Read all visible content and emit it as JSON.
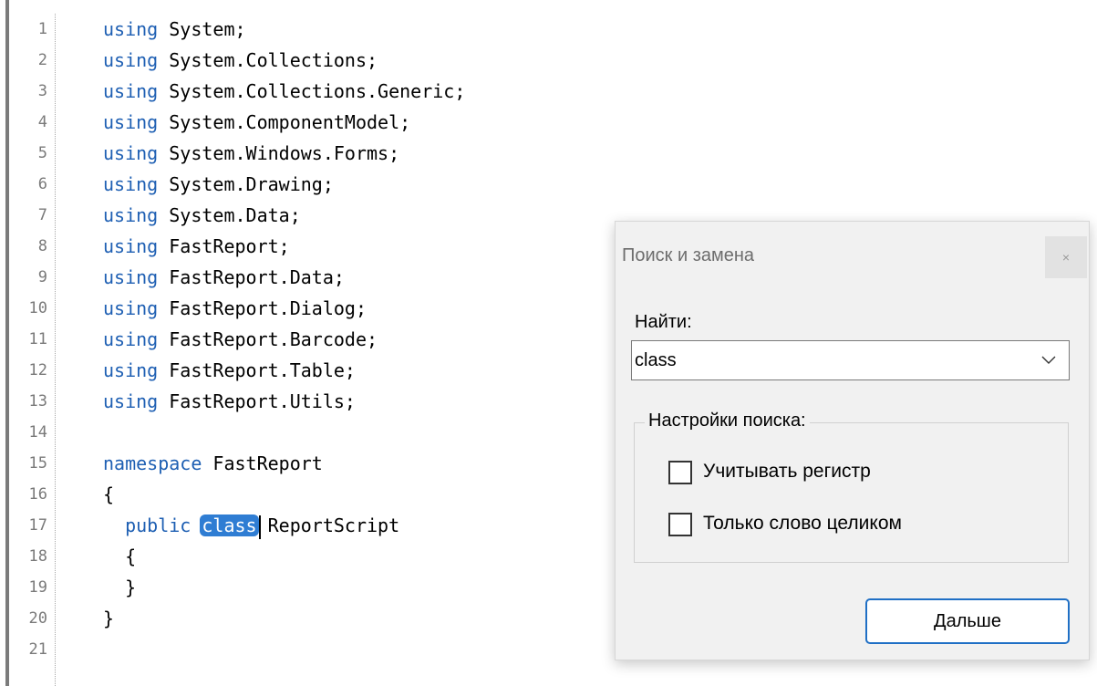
{
  "editor": {
    "line_numbers": [
      "1",
      "2",
      "3",
      "4",
      "5",
      "6",
      "7",
      "8",
      "9",
      "10",
      "11",
      "12",
      "13",
      "14",
      "15",
      "16",
      "17",
      "18",
      "19",
      "20",
      "21"
    ],
    "lines": [
      {
        "kw": "using",
        "rest": " System;"
      },
      {
        "kw": "using",
        "rest": " System.Collections;"
      },
      {
        "kw": "using",
        "rest": " System.Collections.Generic;"
      },
      {
        "kw": "using",
        "rest": " System.ComponentModel;"
      },
      {
        "kw": "using",
        "rest": " System.Windows.Forms;"
      },
      {
        "kw": "using",
        "rest": " System.Drawing;"
      },
      {
        "kw": "using",
        "rest": " System.Data;"
      },
      {
        "kw": "using",
        "rest": " FastReport;"
      },
      {
        "kw": "using",
        "rest": " FastReport.Data;"
      },
      {
        "kw": "using",
        "rest": " FastReport.Dialog;"
      },
      {
        "kw": "using",
        "rest": " FastReport.Barcode;"
      },
      {
        "kw": "using",
        "rest": " FastReport.Table;"
      },
      {
        "kw": "using",
        "rest": " FastReport.Utils;"
      },
      {
        "kw": "",
        "rest": ""
      },
      {
        "kw": "namespace",
        "rest": " FastReport"
      },
      {
        "kw": "",
        "rest": "{"
      },
      {
        "kw": "  public",
        "hl": "class",
        "rest": " ReportScript"
      },
      {
        "kw": "",
        "rest": "  {"
      },
      {
        "kw": "",
        "rest": "  }"
      },
      {
        "kw": "",
        "rest": "}"
      },
      {
        "kw": "",
        "rest": ""
      }
    ]
  },
  "dialog": {
    "title": "Поиск и замена",
    "close_glyph": "×",
    "find_label": "Найти:",
    "find_value": "class",
    "options_title": "Настройки поиска:",
    "match_case_label": "Учитывать регистр",
    "match_case_checked": false,
    "whole_word_label": "Только слово целиком",
    "whole_word_checked": false,
    "next_button": "Дальше"
  },
  "colors": {
    "keyword": "#1e5fb3",
    "highlight": "#2f7dd3",
    "button_border": "#1f6fc5"
  }
}
